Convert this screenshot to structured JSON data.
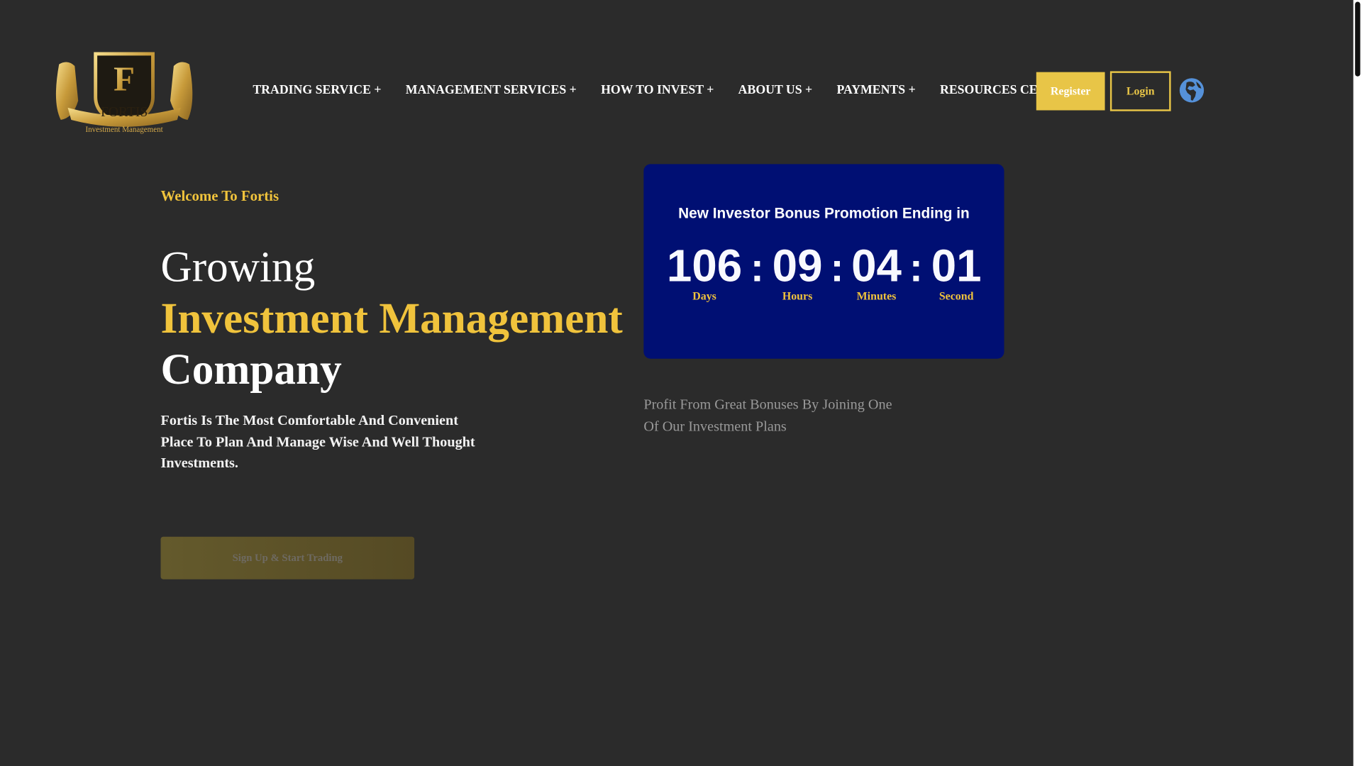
{
  "brand": {
    "name": "FORTIS",
    "tagline": "Investment Management"
  },
  "nav": {
    "items": [
      "TRADING SERVICE +",
      "MANAGEMENT SERVICES +",
      "HOW TO INVEST +",
      "ABOUT US +",
      "PAYMENTS +",
      "RESOURCES CENTER +"
    ],
    "register": "Register",
    "login": "Login",
    "language_icon": "globe-icon"
  },
  "hero": {
    "welcome": "Welcome To Fortis",
    "line1": "Growing",
    "line2": "Investment Management",
    "line3": "Company",
    "description": "Fortis Is The Most Comfortable And Convenient Place To Plan And Manage Wise And Well Thought Investments.",
    "cta": "Sign Up & Start Trading"
  },
  "countdown": {
    "title": "New Investor Bonus Promotion Ending in",
    "days": "106",
    "hours": "09",
    "minutes": "04",
    "seconds": "01",
    "days_label": "Days",
    "hours_label": "Hours",
    "minutes_label": "Minutes",
    "seconds_label": "Second",
    "separator": ":"
  },
  "promo": {
    "text": "Profit From Great Bonuses By Joining One Of Our Investment Plans"
  },
  "colors": {
    "background": "#2b2b2b",
    "gold": "#f0c33c",
    "button": "#e8c547",
    "countdown_bg": "#000f73"
  }
}
